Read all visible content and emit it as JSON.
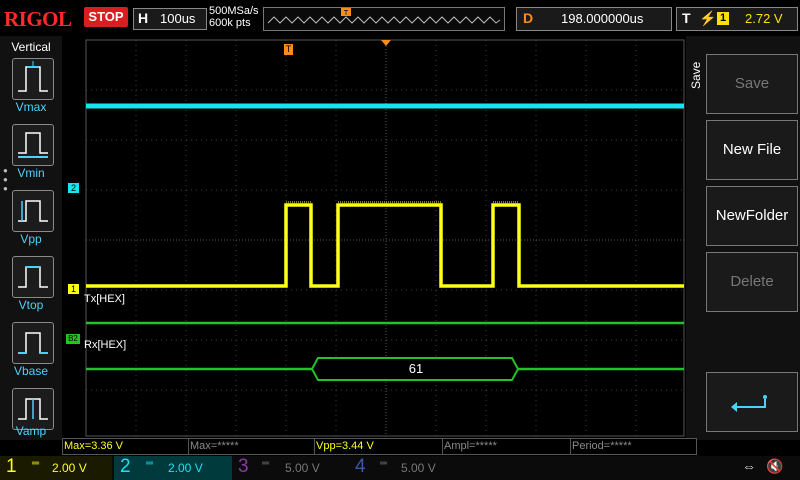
{
  "top": {
    "brand": "RIGOL",
    "run_state": "STOP",
    "horizontal_label": "H",
    "timebase": "100us",
    "sample_rate": "500MSa/s",
    "memory_depth": "600k pts",
    "delay_label": "D",
    "delay_value": "198.000000us",
    "trigger_label": "T",
    "trigger_source": "1",
    "trigger_level": "2.72 V"
  },
  "left_panel": {
    "title": "Vertical",
    "items": [
      {
        "label": "Vmax"
      },
      {
        "label": "Vmin"
      },
      {
        "label": "Vpp"
      },
      {
        "label": "Vtop"
      },
      {
        "label": "Vbase"
      },
      {
        "label": "Vamp"
      }
    ]
  },
  "waveform": {
    "ch2_marker": "2",
    "ch1_marker": "1",
    "b2_marker": "B2",
    "decode_tx_label": "Tx[HEX]",
    "decode_rx_label": "Rx[HEX]",
    "rx_value": "61",
    "trigger_marker": "T",
    "colors": {
      "ch1": "#ffff1a",
      "ch2": "#16e5f0",
      "decode": "#22c22a",
      "grid": "#3d3d3d",
      "trigger": "#ff8c1a"
    }
  },
  "right_menu": {
    "section": "Save",
    "items": [
      {
        "label": "Save",
        "enabled": false
      },
      {
        "label": "New File",
        "enabled": true
      },
      {
        "label": "NewFolder",
        "enabled": true
      },
      {
        "label": "Delete",
        "enabled": false
      }
    ],
    "back_icon": "return-arrow-icon"
  },
  "measurements": [
    {
      "text": "Max=3.36 V"
    },
    {
      "text": "Max=*****"
    },
    {
      "text": "Vpp=3.44 V"
    },
    {
      "text": "Ampl=*****"
    },
    {
      "text": "Period=*****"
    }
  ],
  "channels": [
    {
      "num": "1",
      "scale": "2.00 V",
      "color": "#ffff1a"
    },
    {
      "num": "2",
      "scale": "2.00 V",
      "color": "#16e5f0"
    },
    {
      "num": "3",
      "scale": "5.00 V",
      "color": "#8a3aa0"
    },
    {
      "num": "4",
      "scale": "5.00 V",
      "color": "#3a5aa8"
    }
  ]
}
